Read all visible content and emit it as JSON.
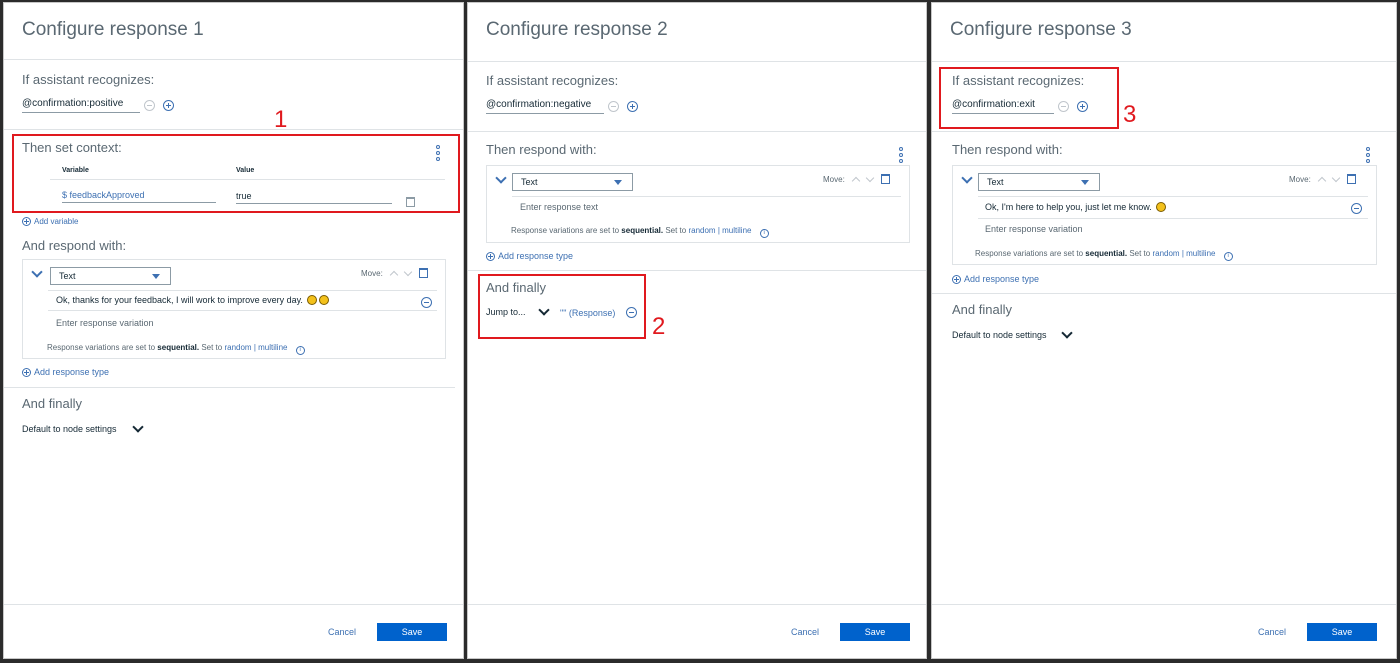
{
  "panel1": {
    "title": "Configure response 1",
    "if_label": "If assistant recognizes:",
    "condition": "@confirmation:positive",
    "context_label": "Then set context:",
    "col_variable": "Variable",
    "col_value": "Value",
    "variable": "$ feedbackApproved",
    "value": "true",
    "add_variable": "Add variable",
    "respond_label": "And respond with:",
    "response_type": "Text",
    "move_label": "Move:",
    "variation_text": "Ok, thanks for your feedback, I will work to improve every day.",
    "variation_placeholder": "Enter response variation",
    "variation_note_prefix": "Response variations are set to",
    "variation_note_mode": "sequential.",
    "variation_note_setto": "Set to",
    "link_random": "random",
    "link_sep": "|",
    "link_multiline": "multiline",
    "add_response_type": "Add response type",
    "finally_label": "And finally",
    "finally_value": "Default to node settings",
    "cancel": "Cancel",
    "save": "Save",
    "annotation": "1"
  },
  "panel2": {
    "title": "Configure response 2",
    "if_label": "If assistant recognizes:",
    "condition": "@confirmation:negative",
    "respond_label": "Then respond with:",
    "response_type": "Text",
    "move_label": "Move:",
    "response_placeholder": "Enter response text",
    "variation_note_prefix": "Response variations are set to",
    "variation_note_mode": "sequential.",
    "variation_note_setto": "Set to",
    "link_random": "random",
    "link_sep": "|",
    "link_multiline": "multiline",
    "add_response_type": "Add response type",
    "finally_label": "And finally",
    "jump_label": "Jump to...",
    "jump_target": "\"\" (Response)",
    "cancel": "Cancel",
    "save": "Save",
    "annotation": "2"
  },
  "panel3": {
    "title": "Configure response 3",
    "if_label": "If assistant recognizes:",
    "condition": "@confirmation:exit",
    "respond_label": "Then respond with:",
    "response_type": "Text",
    "move_label": "Move:",
    "variation_text": "Ok, I'm here to help you, just let me know.",
    "variation_placeholder": "Enter response variation",
    "variation_note_prefix": "Response variations are set to",
    "variation_note_mode": "sequential.",
    "variation_note_setto": "Set to",
    "link_random": "random",
    "link_sep": "|",
    "link_multiline": "multiline",
    "add_response_type": "Add response type",
    "finally_label": "And finally",
    "finally_value": "Default to node settings",
    "cancel": "Cancel",
    "save": "Save",
    "annotation": "3"
  },
  "colors": {
    "accent": "#3d70b2",
    "save_button": "#0062cc",
    "annotation_red": "#e0191e"
  }
}
